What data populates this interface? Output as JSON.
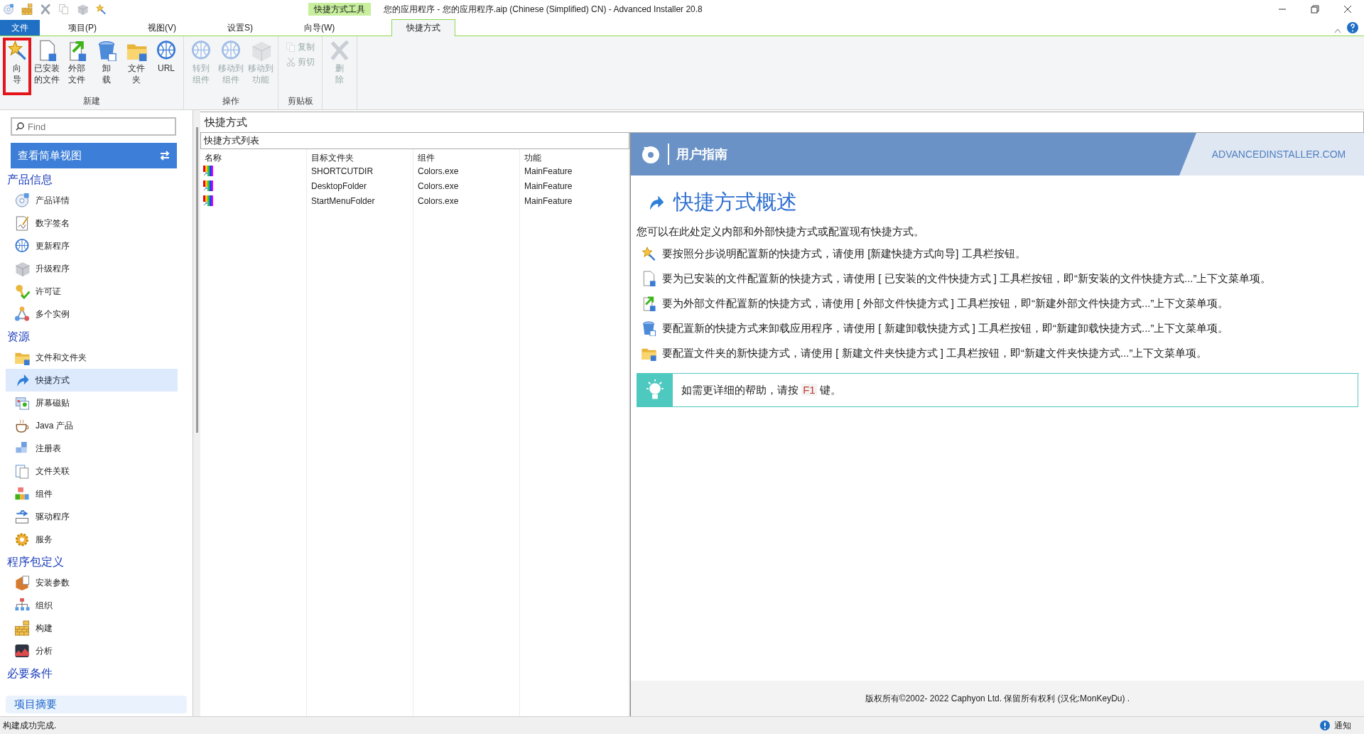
{
  "title_bar": {
    "context_group": "快捷方式工具",
    "title": "您的应用程序 - 您的应用程序.aip (Chinese (Simplified) CN) - Advanced Installer 20.8"
  },
  "menu_tabs": [
    {
      "label": "文件",
      "kind": "file",
      "selected": false
    },
    {
      "label": "项目(P)",
      "kind": "tab",
      "selected": false
    },
    {
      "label": "视图(V)",
      "kind": "tab",
      "selected": false
    },
    {
      "label": "设置S)",
      "kind": "tab",
      "selected": false
    },
    {
      "label": "向导(W)",
      "kind": "tab",
      "selected": false
    },
    {
      "label": "快捷方式",
      "kind": "tab",
      "selected": true
    }
  ],
  "ribbon_groups": [
    {
      "label": "新建",
      "buttons": [
        {
          "lines": [
            "向",
            "导"
          ],
          "disabled": false,
          "annotated": true
        },
        {
          "lines": [
            "已安装",
            "的文件"
          ],
          "disabled": false
        },
        {
          "lines": [
            "外部",
            "文件"
          ],
          "disabled": false
        },
        {
          "lines": [
            "卸",
            "载"
          ],
          "disabled": false
        },
        {
          "lines": [
            "文件",
            "夹"
          ],
          "disabled": false
        },
        {
          "lines": [
            "URL"
          ],
          "disabled": false
        }
      ]
    },
    {
      "label": "操作",
      "buttons": [
        {
          "lines": [
            "转到",
            "组件"
          ],
          "disabled": true
        },
        {
          "lines": [
            "移动到",
            "组件"
          ],
          "disabled": true
        },
        {
          "lines": [
            "移动到",
            "功能"
          ],
          "disabled": true
        }
      ]
    },
    {
      "label": "剪贴板",
      "small_buttons": [
        {
          "label": "复制",
          "disabled": true
        },
        {
          "label": "剪切",
          "disabled": true
        }
      ]
    },
    {
      "buttons": [
        {
          "lines": [
            "删",
            "除"
          ],
          "disabled": true
        }
      ]
    }
  ],
  "sidebar": {
    "search": {
      "placeholder": "Find"
    },
    "view_button": "查看简单视图",
    "sections": [
      {
        "title": "产品信息",
        "items": [
          {
            "label": "产品详情",
            "selected": false
          },
          {
            "label": "数字签名",
            "selected": false
          },
          {
            "label": "更新程序",
            "selected": false
          },
          {
            "label": "升级程序",
            "selected": false
          },
          {
            "label": "许可证",
            "selected": false
          },
          {
            "label": "多个实例",
            "selected": false
          }
        ]
      },
      {
        "title": "资源",
        "items": [
          {
            "label": "文件和文件夹",
            "selected": false
          },
          {
            "label": "快捷方式",
            "selected": true
          },
          {
            "label": "屏幕磁贴",
            "selected": false
          },
          {
            "label": "Java 产品",
            "selected": false
          },
          {
            "label": "注册表",
            "selected": false
          },
          {
            "label": "文件关联",
            "selected": false
          },
          {
            "label": "组件",
            "selected": false
          },
          {
            "label": "驱动程序",
            "selected": false
          },
          {
            "label": "服务",
            "selected": false
          }
        ]
      },
      {
        "title": "程序包定义",
        "items": [
          {
            "label": "安装参数",
            "selected": false
          },
          {
            "label": "组织",
            "selected": false
          },
          {
            "label": "构建",
            "selected": false
          },
          {
            "label": "分析",
            "selected": false
          }
        ]
      },
      {
        "title": "必要条件"
      }
    ],
    "summary": "项目摘要"
  },
  "page_title": "快捷方式",
  "table": {
    "title": "快捷方式列表",
    "columns": [
      "名称",
      "目标文件夹",
      "组件",
      "功能"
    ],
    "rows": [
      {
        "target": "SHORTCUTDIR",
        "component": "Colors.exe",
        "feature": "MainFeature"
      },
      {
        "target": "DesktopFolder",
        "component": "Colors.exe",
        "feature": "MainFeature"
      },
      {
        "target": "StartMenuFolder",
        "component": "Colors.exe",
        "feature": "MainFeature"
      }
    ]
  },
  "guide": {
    "header": "用户指南",
    "site": "ADVANCEDINSTALLER.COM",
    "heading": "快捷方式概述",
    "intro": "您可以在此处定义内部和外部快捷方式或配置现有快捷方式。",
    "tips": [
      "要按照分步说明配置新的快捷方式，请使用 [新建快捷方式向导] 工具栏按钮。",
      "要为已安装的文件配置新的快捷方式，请使用 [ 已安装的文件快捷方式 ] 工具栏按钮，即“新安装的文件快捷方式...”上下文菜单项。",
      "要为外部文件配置新的快捷方式，请使用 [ 外部文件快捷方式 ] 工具栏按钮，即“新建外部文件快捷方式...”上下文菜单项。",
      "要配置新的快捷方式来卸载应用程序，请使用 [ 新建卸载快捷方式 ] 工具栏按钮，即“新建卸载快捷方式...”上下文菜单项。",
      "要配置文件夹的新快捷方式，请使用 [ 新建文件夹快捷方式 ] 工具栏按钮，即“新建文件夹快捷方式...”上下文菜单项。"
    ],
    "hint": {
      "before": "如需更详细的帮助，请按",
      "key": "F1",
      "after": "键。"
    },
    "copyright": "版权所有©2002- 2022 Caphyon Ltd. 保留所有权利 (汉化:MonKeyDu) ."
  },
  "status_bar": {
    "message": "构建成功完成.",
    "notifications": "通知"
  }
}
